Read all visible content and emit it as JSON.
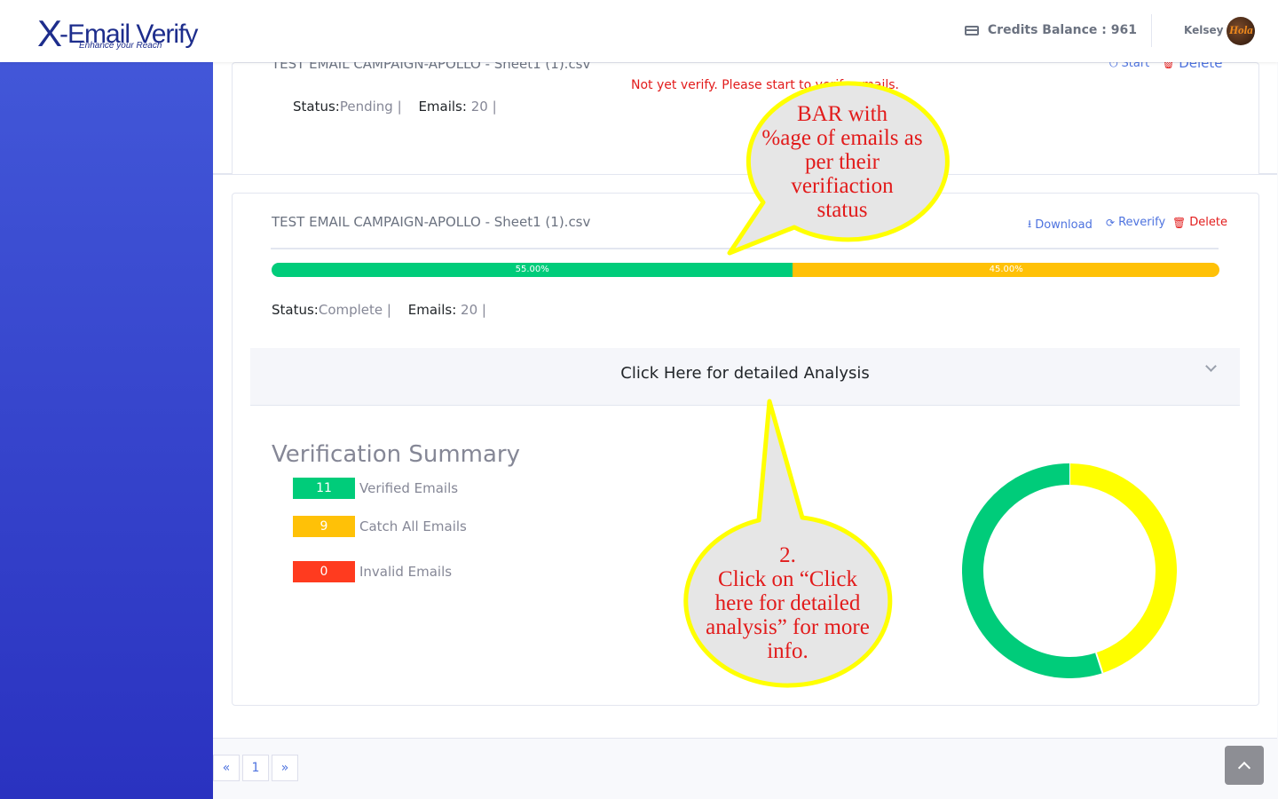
{
  "header": {
    "logo_main": "-Email Verify",
    "logo_x": "X",
    "logo_tagline": "Enhance your Reach",
    "credits_label": "Credits Balance : 961",
    "user_name": "Kelsey",
    "avatar_text": "Hola"
  },
  "campaigns": [
    {
      "file_name": "TEST EMAIL CAMPAIGN-APOLLO - Sheet1 (1).csv",
      "actions": {
        "start": "Start",
        "delete": "Delete"
      },
      "warning": "Not yet verify. Please start to verify emails.",
      "status_label": "Status:",
      "status_value": "Pending |",
      "emails_label": "Emails:",
      "emails_value": "20 |"
    },
    {
      "file_name": "TEST EMAIL CAMPAIGN-APOLLO - Sheet1 (1).csv",
      "actions": {
        "download": "Download",
        "reverify": "Reverify",
        "delete": "Delete"
      },
      "progress": [
        {
          "label": "55.00%",
          "value": 55,
          "color": "#00cc7a"
        },
        {
          "label": "45.00%",
          "value": 45,
          "color": "#ffc107"
        }
      ],
      "status_label": "Status:",
      "status_value": "Complete |",
      "emails_label": "Emails:",
      "emails_value": "20 |",
      "accordion_title": "Click Here for detailed Analysis",
      "summary": {
        "title": "Verification Summary",
        "rows": [
          {
            "count": "11",
            "label": "Verified Emails",
            "color": "#00cc7a"
          },
          {
            "count": "9",
            "label": "Catch All Emails",
            "color": "#ffc107"
          },
          {
            "count": "0",
            "label": "Invalid Emails",
            "color": "#ff3b1f"
          }
        ]
      }
    }
  ],
  "chart_data": {
    "type": "pie",
    "categories": [
      "Verified Emails",
      "Catch All Emails",
      "Invalid Emails"
    ],
    "values": [
      11,
      9,
      0
    ],
    "colors": [
      "#00cc7a",
      "#ffff00",
      "#ff3b1f"
    ],
    "title": "",
    "legend": "none"
  },
  "callouts": [
    {
      "lines": [
        "BAR with",
        "%age of emails as",
        "per their",
        "verifiaction",
        "status"
      ]
    },
    {
      "lines": [
        "2.",
        "Click on “Click",
        "here for detailed",
        "analysis” for more",
        "info."
      ]
    }
  ],
  "pagination": {
    "prev": "«",
    "page": "1",
    "next": "»"
  },
  "icons": {
    "credit_card": "credit-card-icon",
    "start": "power-icon",
    "delete": "trash-icon",
    "download": "download-icon",
    "reverify": "sync-icon",
    "chevron": "chevron-down-icon",
    "scroll_top": "chevron-up-icon"
  }
}
